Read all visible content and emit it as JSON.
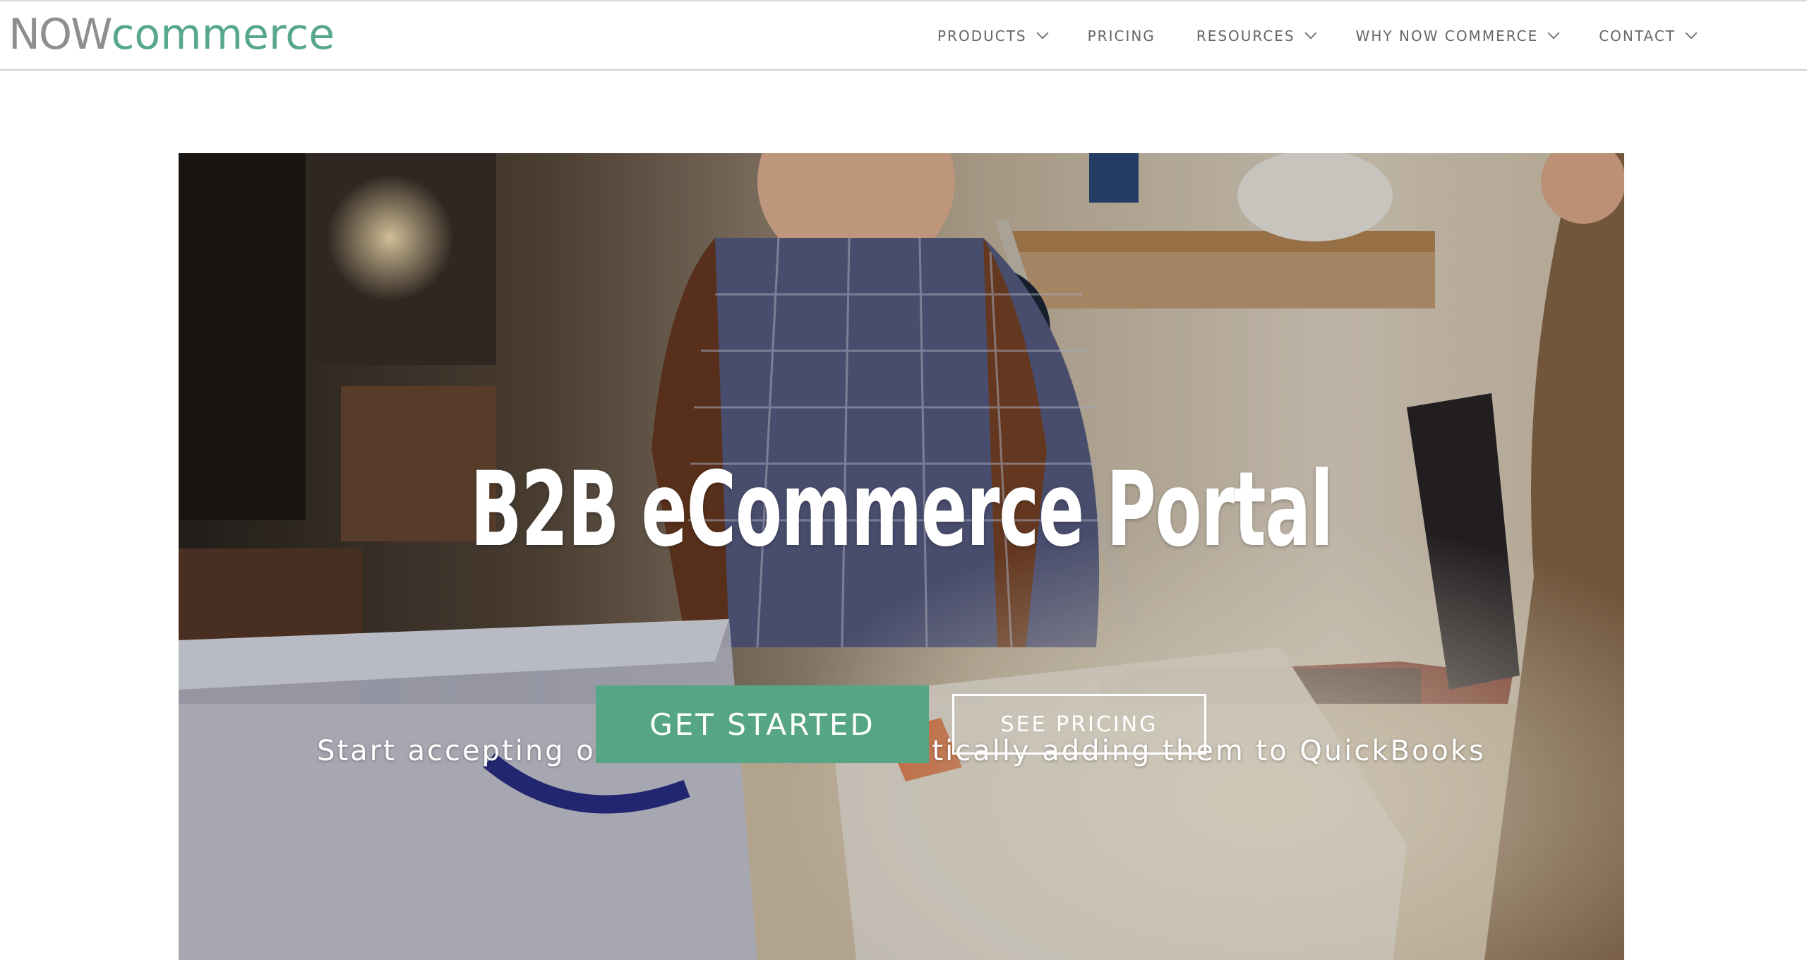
{
  "header": {
    "logo": {
      "now": "NOW",
      "commerce": "commerce"
    },
    "nav": [
      {
        "label": "PRODUCTS",
        "has_dropdown": true
      },
      {
        "label": "PRICING",
        "has_dropdown": false
      },
      {
        "label": "RESOURCES",
        "has_dropdown": true
      },
      {
        "label": "WHY NOW COMMERCE",
        "has_dropdown": true
      },
      {
        "label": "CONTACT",
        "has_dropdown": true
      }
    ]
  },
  "hero": {
    "title": "B2B eCommerce Portal",
    "subtitle": "Start accepting online orders, automatically adding them to QuickBooks",
    "primary_button": "GET STARTED",
    "secondary_button": "SEE PRICING",
    "image_description_icon": "photo-hero-image"
  },
  "colors": {
    "brand_green": "#56a685",
    "logo_gray": "#8e8e8e",
    "nav_text": "#666666"
  }
}
